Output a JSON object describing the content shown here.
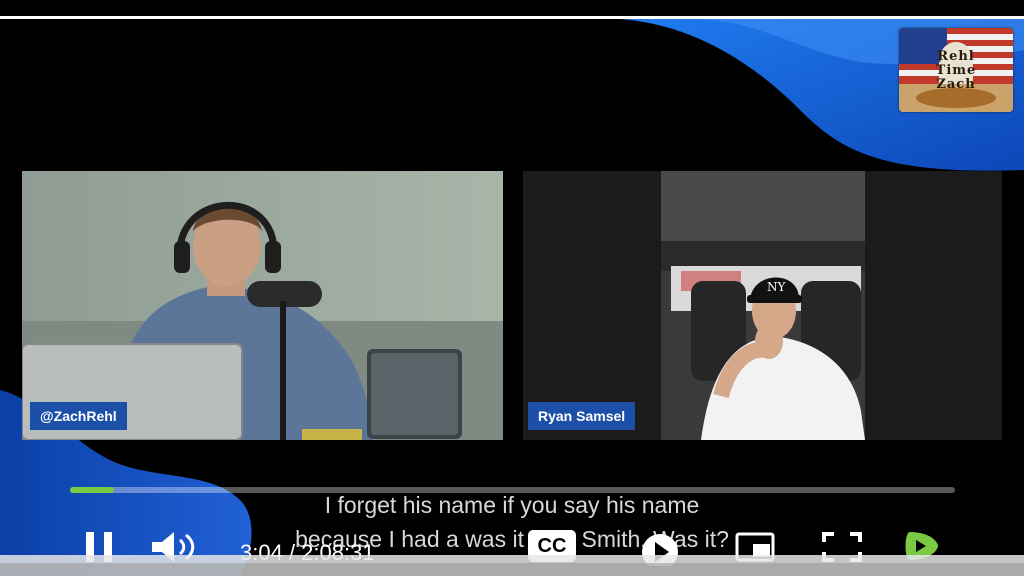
{
  "logo": {
    "line1": "Rehl",
    "line2": "Time",
    "line3": "Zach"
  },
  "participants": [
    {
      "name": "@ZachRehl"
    },
    {
      "name": "Ryan Samsel"
    }
  ],
  "captions": {
    "line1": "I forget his name if you say his name",
    "line2": "because I had a was it Nick Smith. Was it?"
  },
  "player": {
    "current_time": "3:04",
    "separator": " / ",
    "duration": "2:08:31",
    "progress_fraction": 0.024,
    "cc_label": "CC"
  },
  "icons": {
    "pause": "pause-icon",
    "volume": "volume-icon",
    "cc": "captions-icon",
    "play": "play-circle-icon",
    "miniplayer": "miniplayer-icon",
    "fullscreen": "fullscreen-icon",
    "brand": "rumble-icon"
  },
  "colors": {
    "accent_blue": "#1b5fd9",
    "progress_green": "#7ac943",
    "tag_blue": "#1b4fa8"
  }
}
